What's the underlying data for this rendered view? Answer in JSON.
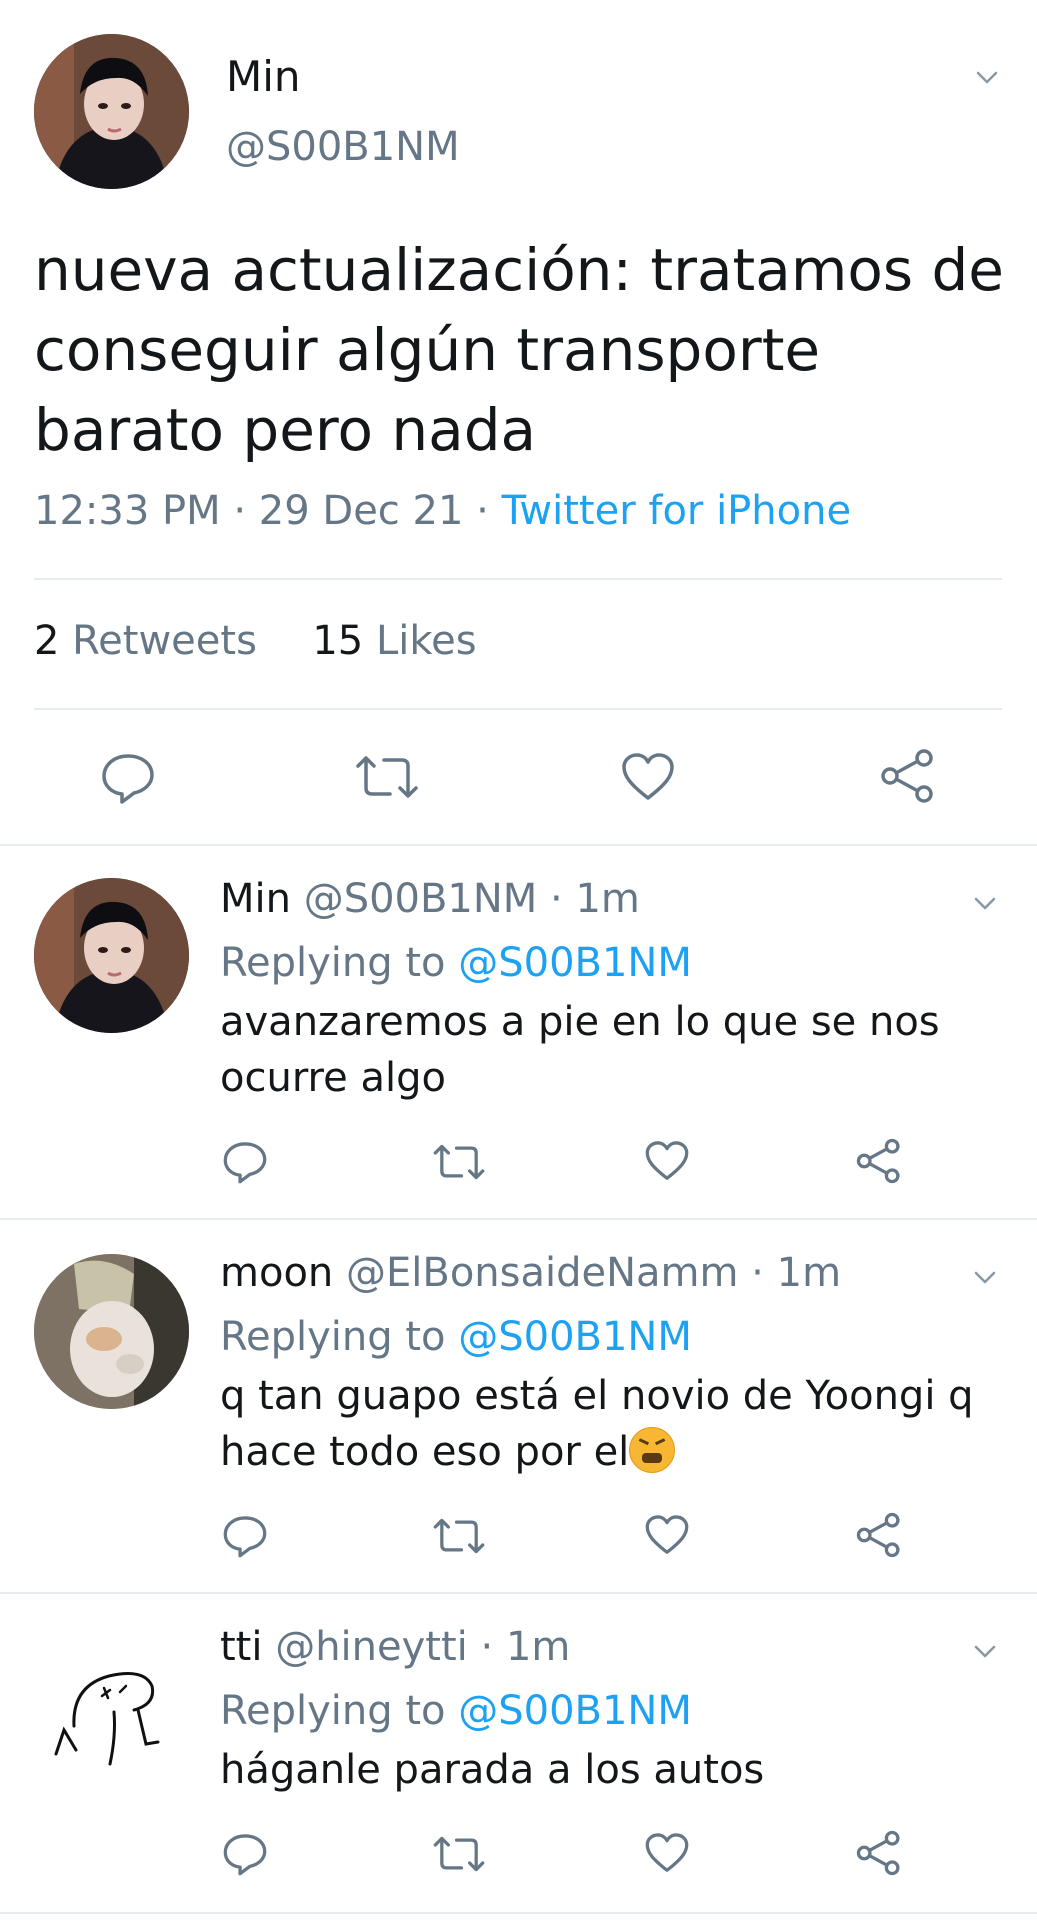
{
  "main": {
    "name": "Min",
    "handle": "@S00B1NM",
    "text": "nueva actualización: tratamos de conseguir algún transporte barato pero nada",
    "time": "12:33 PM",
    "date": "29 Dec 21",
    "source": "Twitter for iPhone",
    "separator": " · ",
    "retweets_count": "2",
    "retweets_label": "Retweets",
    "likes_count": "15",
    "likes_label": "Likes"
  },
  "replies": [
    {
      "name": "Min",
      "handle": "@S00B1NM",
      "time": "1m",
      "replying_prefix": "Replying to",
      "replying_to": "@S00B1NM",
      "text": "avanzaremos a pie en lo que se nos ocurre algo"
    },
    {
      "name": "moon",
      "handle": "@ElBonsaideNamm",
      "time": "1m",
      "replying_prefix": "Replying to",
      "replying_to": "@S00B1NM",
      "text": "q tan guapo está el novio de Yoongi q hace todo eso por el"
    },
    {
      "name": "tti",
      "handle": "@hineytti",
      "time": "1m",
      "replying_prefix": "Replying to",
      "replying_to": "@S00B1NM",
      "text": "háganle parada a los autos"
    }
  ],
  "icons": {
    "reply": "reply-icon",
    "retweet": "retweet-icon",
    "like": "heart-icon",
    "share": "share-icon",
    "more": "chevron-down-icon",
    "emoji": "tired-face-emoji"
  },
  "colors": {
    "text": "#14171a",
    "secondary": "#657786",
    "accent": "#1da1f2",
    "divider": "#e6ecf0"
  }
}
